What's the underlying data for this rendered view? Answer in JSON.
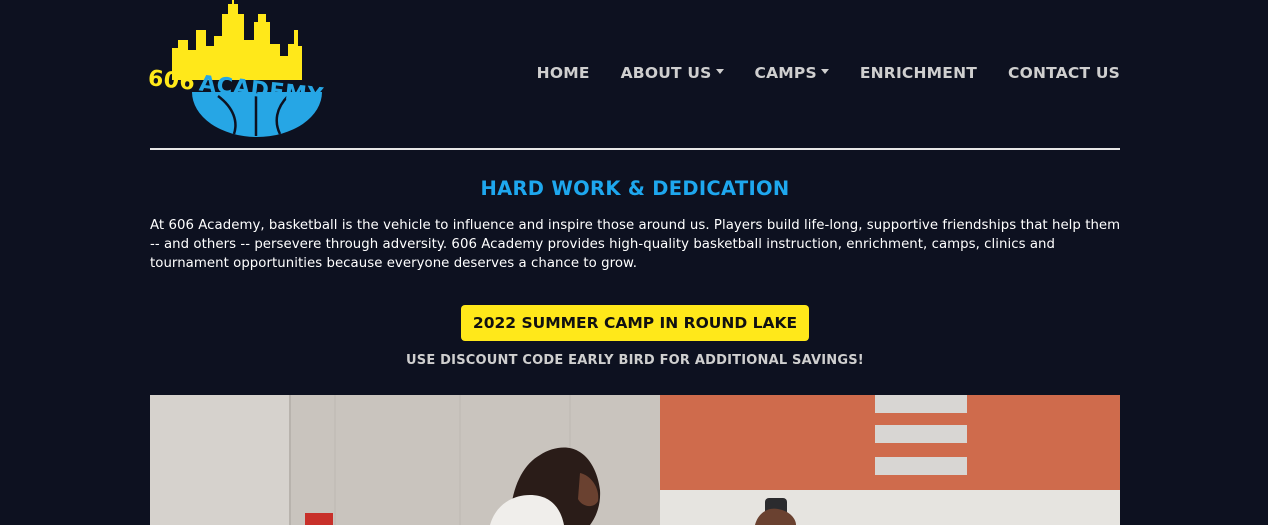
{
  "logo": {
    "number": "606",
    "name": "ACADEMY"
  },
  "nav": {
    "items": [
      {
        "label": "HOME",
        "dropdown": false
      },
      {
        "label": "ABOUT US",
        "dropdown": true
      },
      {
        "label": "CAMPS",
        "dropdown": true
      },
      {
        "label": "ENRICHMENT",
        "dropdown": false
      },
      {
        "label": "CONTACT US",
        "dropdown": false
      }
    ]
  },
  "main": {
    "headline": "HARD WORK & DEDICATION",
    "intro": "At 606 Academy, basketball is the vehicle to influence and inspire those around us. Players build life-long, supportive friendships that help them -- and others -- persevere through adversity. 606 Academy provides high-quality basketball instruction, enrichment, camps, clinics and tournament opportunities because everyone deserves a chance to grow.",
    "cta_label": "2022 SUMMER CAMP IN ROUND LAKE",
    "discount_note": "USE DISCOUNT CODE EARLY BIRD FOR ADDITIONAL SAVINGS!"
  },
  "colors": {
    "background": "#0d1120",
    "accent_blue": "#1ea7ee",
    "accent_yellow": "#ffe81a",
    "nav_text": "#cfcfcf"
  }
}
